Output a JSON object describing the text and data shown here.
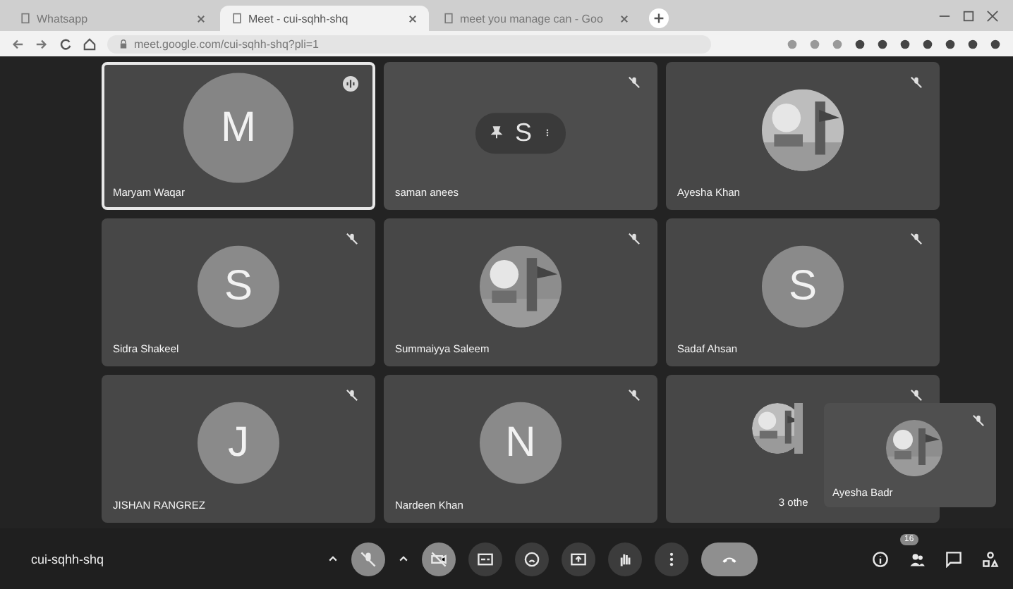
{
  "browser": {
    "tabs": [
      {
        "title": "Whatsapp",
        "selected": false
      },
      {
        "title": "Meet - cui-sqhh-shq",
        "selected": true
      },
      {
        "title": "meet you manage can - Goo",
        "selected": false
      }
    ],
    "url": "meet.google.com/cui-sqhh-shq?pli=1"
  },
  "tiles": [
    {
      "name": "Maryam Waqar",
      "kind": "letter",
      "letter": "M",
      "speaking": true,
      "hovered": false
    },
    {
      "name": "saman anees",
      "kind": "letter",
      "letter": "S",
      "speaking": false,
      "hovered": true
    },
    {
      "name": "Ayesha Khan",
      "speaking": false,
      "hovered": false
    },
    {
      "name": "Sidra Shakeel",
      "kind": "letter",
      "letter": "S",
      "speaking": false,
      "hovered": false
    },
    {
      "name": "Summaiyya Saleem",
      "speaking": false,
      "hovered": false
    },
    {
      "name": "Sadaf Ahsan",
      "kind": "letter",
      "letter": "S",
      "speaking": false,
      "hovered": false
    },
    {
      "name": "JISHAN RANGREZ",
      "kind": "letter",
      "letter": "J",
      "speaking": false,
      "hovered": false
    },
    {
      "name": "Nardeen Khan",
      "kind": "letter",
      "letter": "N",
      "speaking": false,
      "hovered": false
    },
    {
      "name": "3 othe",
      "kind": "others",
      "speaking": false,
      "hovered": false
    }
  ],
  "self_view": {
    "name": "Ayesha Badr"
  },
  "meeting_code": "cui-sqhh-shq",
  "participant_count": "16"
}
